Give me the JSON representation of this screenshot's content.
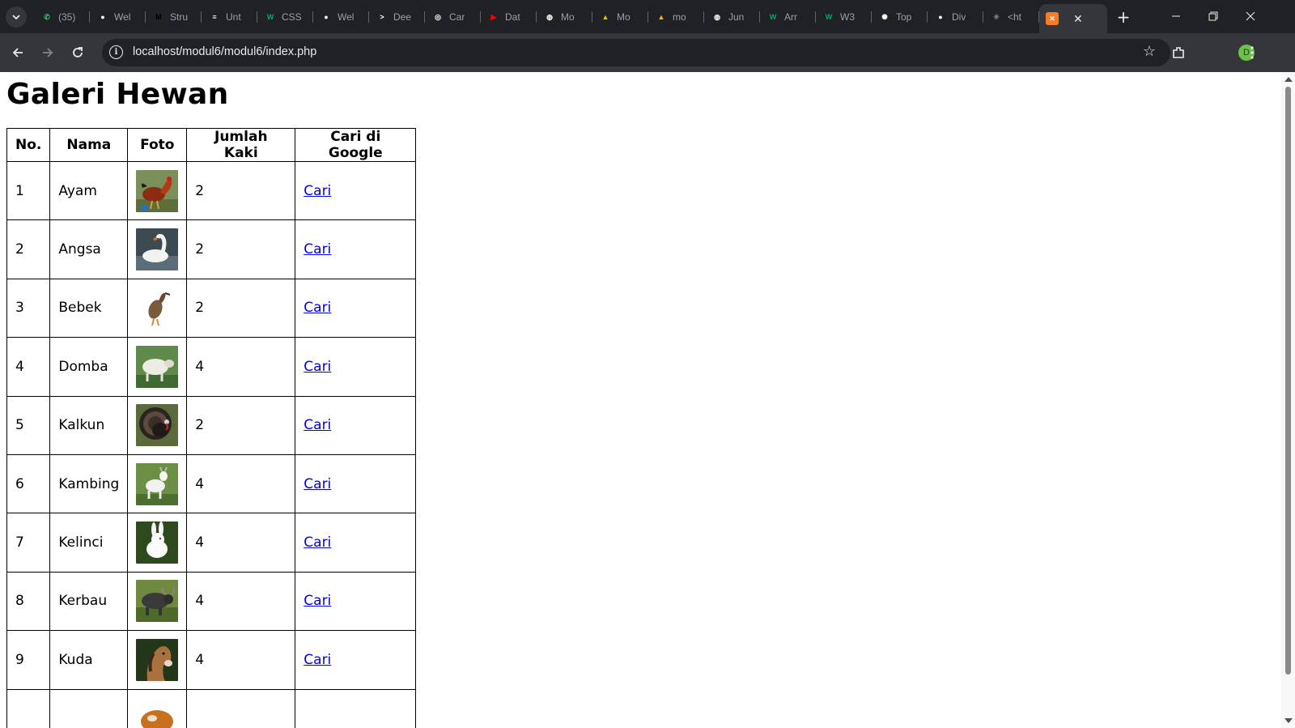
{
  "browser": {
    "tabs": [
      {
        "label": "(35)",
        "favicon": "whatsapp-icon",
        "color": "#25d366"
      },
      {
        "label": "Wel",
        "favicon": "github-icon",
        "color": "#ffffff"
      },
      {
        "label": "Stru",
        "favicon": "medium-icon",
        "color": "#000000"
      },
      {
        "label": "Unt",
        "favicon": "stackby-icon",
        "color": "#ffffff"
      },
      {
        "label": "CSS",
        "favicon": "w3schools-icon",
        "color": "#04aa6d"
      },
      {
        "label": "Wel",
        "favicon": "github-icon",
        "color": "#ffffff"
      },
      {
        "label": "Dee",
        "favicon": "terminal-icon",
        "color": "#ffffff"
      },
      {
        "label": "Car",
        "favicon": "chrome-settings-icon",
        "color": "#ffffff"
      },
      {
        "label": "Dat",
        "favicon": "youtube-icon",
        "color": "#ff0000"
      },
      {
        "label": "Mo",
        "favicon": "globe-icon",
        "color": "#ffffff"
      },
      {
        "label": "Mo",
        "favicon": "google-drive-icon",
        "color": "#fbbc04"
      },
      {
        "label": "mo",
        "favicon": "google-drive-icon",
        "color": "#fbbc04"
      },
      {
        "label": "Jun",
        "favicon": "globe-icon",
        "color": "#ffffff"
      },
      {
        "label": "Arr",
        "favicon": "w3schools-icon",
        "color": "#04aa6d"
      },
      {
        "label": "W3",
        "favicon": "w3schools-icon",
        "color": "#04aa6d"
      },
      {
        "label": "Top",
        "favicon": "openai-icon",
        "color": "#ffffff"
      },
      {
        "label": "Div",
        "favicon": "github-icon",
        "color": "#ffffff"
      },
      {
        "label": "<ht",
        "favicon": "dots-icon",
        "color": "#888888"
      }
    ],
    "active_tab": {
      "label": "",
      "favicon": "xampp-icon",
      "color": "#fb7a24"
    },
    "url": "localhost/modul6/modul6/index.php",
    "profile_initial": "D"
  },
  "page": {
    "title": "Galeri Hewan",
    "columns": [
      "No.",
      "Nama",
      "Foto",
      "Jumlah Kaki",
      "Cari di Google"
    ],
    "rows": [
      {
        "no": "1",
        "nama": "Ayam",
        "photo": "rooster",
        "kaki": "2",
        "link": "Cari"
      },
      {
        "no": "2",
        "nama": "Angsa",
        "photo": "swan",
        "kaki": "2",
        "link": "Cari"
      },
      {
        "no": "3",
        "nama": "Bebek",
        "photo": "duck",
        "kaki": "2",
        "link": "Cari"
      },
      {
        "no": "4",
        "nama": "Domba",
        "photo": "sheep",
        "kaki": "4",
        "link": "Cari"
      },
      {
        "no": "5",
        "nama": "Kalkun",
        "photo": "turkey",
        "kaki": "2",
        "link": "Cari"
      },
      {
        "no": "6",
        "nama": "Kambing",
        "photo": "goat",
        "kaki": "4",
        "link": "Cari"
      },
      {
        "no": "7",
        "nama": "Kelinci",
        "photo": "rabbit",
        "kaki": "4",
        "link": "Cari"
      },
      {
        "no": "8",
        "nama": "Kerbau",
        "photo": "buffalo",
        "kaki": "4",
        "link": "Cari"
      },
      {
        "no": "9",
        "nama": "Kuda",
        "photo": "horse",
        "kaki": "4",
        "link": "Cari"
      },
      {
        "no": "",
        "nama": "",
        "photo": "cow",
        "kaki": "",
        "link": ""
      }
    ]
  }
}
